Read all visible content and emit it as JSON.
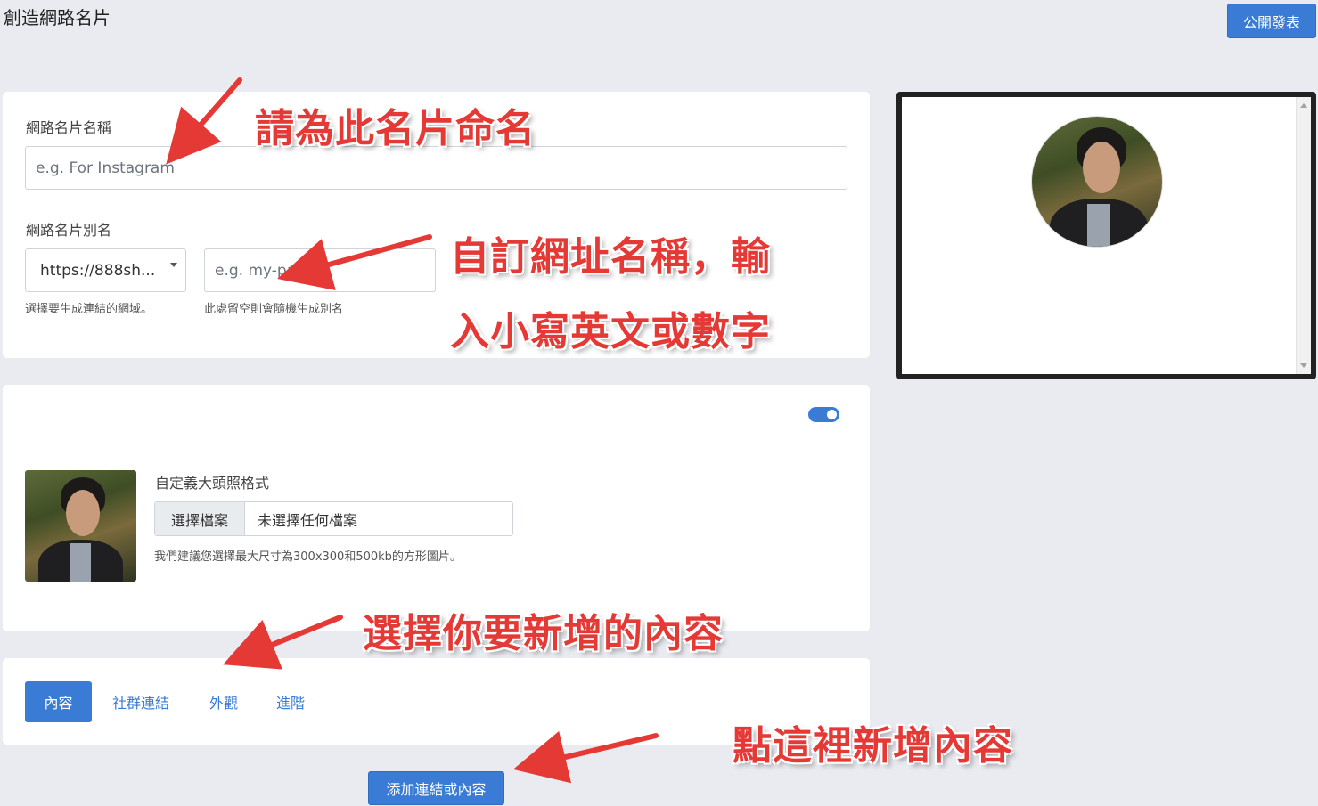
{
  "header": {
    "title": "創造網路名片",
    "publish_label": "公開發表"
  },
  "name_section": {
    "label": "網路名片名稱",
    "placeholder": "e.g. For Instagram"
  },
  "alias_section": {
    "label": "網路名片別名",
    "domain_value": "https://888sh...",
    "domain_helper": "選擇要生成連結的網域。",
    "slug_placeholder": "e.g. my-pag",
    "slug_helper": "此處留空則會隨機生成別名"
  },
  "avatar_section": {
    "toggle_on": true,
    "label": "自定義大頭照格式",
    "choose_file_label": "選擇檔案",
    "file_status": "未選擇任何檔案",
    "helper": "我們建議您選擇最大尺寸為300x300和500kb的方形圖片。"
  },
  "tabs": [
    {
      "label": "內容",
      "active": true
    },
    {
      "label": "社群連結",
      "active": false
    },
    {
      "label": "外觀",
      "active": false
    },
    {
      "label": "進階",
      "active": false
    }
  ],
  "add_button_label": "添加連結或內容",
  "annotations": {
    "name_note": "請為此名片命名",
    "slug_note_line1": "自訂網址名稱，輸",
    "slug_note_line2": "入小寫英文或數字",
    "content_note": "選擇你要新增的內容",
    "add_note": "點這裡新增內容"
  },
  "colors": {
    "accent": "#3a7bd5",
    "annotation": "#e53935",
    "background": "#e9ebf0"
  }
}
